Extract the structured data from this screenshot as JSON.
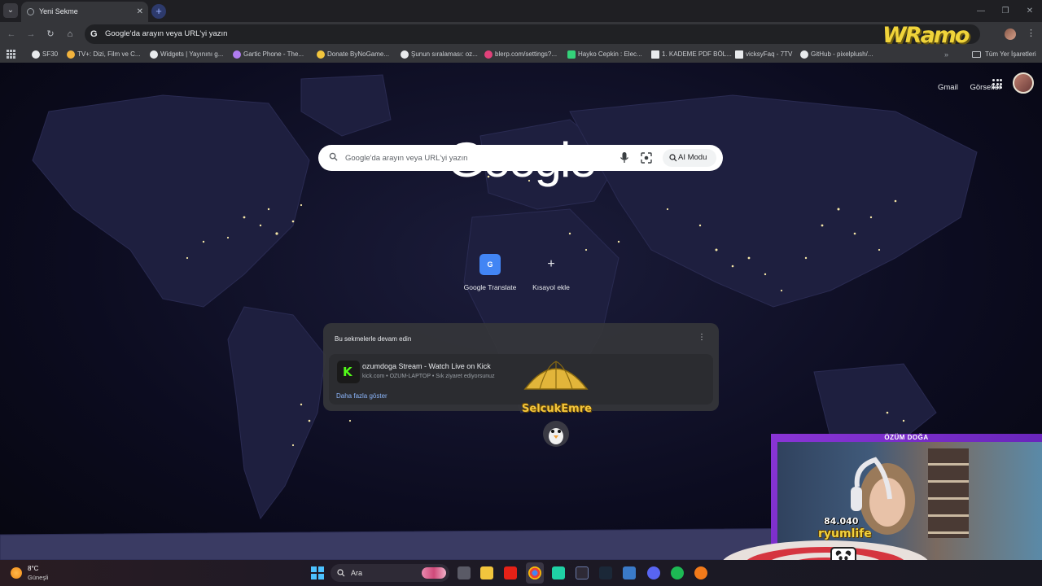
{
  "browser": {
    "tab": {
      "title": "Yeni Sekme"
    },
    "omnibox": {
      "text": "Google'da arayın veya URL'yi yazın"
    },
    "bookmarks": [
      {
        "label": "SF30",
        "color": "#e8eaed"
      },
      {
        "label": "TV+: Dizi, Film ve C...",
        "color": "#f2b33d"
      },
      {
        "label": "Widgets | Yayınını g...",
        "color": "#e8eaed"
      },
      {
        "label": "Gartic Phone - The...",
        "color": "#b07cf0"
      },
      {
        "label": "Donate ByNoGame...",
        "color": "#f2c53d"
      },
      {
        "label": "Şunun sıralaması: oz...",
        "color": "#e8eaed"
      },
      {
        "label": "blerp.com/settings?...",
        "color": "#e0417a"
      },
      {
        "label": "Hayko Cepkin : Elec...",
        "color": "#34d27a"
      },
      {
        "label": "1. KADEME PDF BÖL...",
        "color": "#e8eaed"
      },
      {
        "label": "vicksyFaq - 7TV",
        "color": "#e8eaed"
      },
      {
        "label": "GitHub - pixelplush/...",
        "color": "#e8eaed"
      }
    ],
    "bookmarks_more": "»",
    "bookmarks_folder": "Tüm Yer İşaretleri",
    "stream_logo": "WRamo"
  },
  "page": {
    "top_links": {
      "gmail": "Gmail",
      "images": "Görseller"
    },
    "logo": "Google",
    "search": {
      "placeholder": "Google'da arayın veya URL'yi yazın",
      "ai_mode_label": "AI Modu"
    },
    "shortcuts": [
      {
        "label": "Google Translate",
        "icon": "translate-icon"
      },
      {
        "label": "Kısayol ekle",
        "icon": "plus-icon"
      }
    ],
    "continue_card": {
      "title": "Bu sekmelerle devam edin",
      "item_title": "ozumdoga Stream - Watch Live on Kick",
      "item_subtitle": "kick.com • OZUM-LAPTOP • Sık ziyaret ediyorsunuz",
      "show_more": "Daha fazla göster"
    }
  },
  "stream_overlay": {
    "alert_name": "SelcukEmre",
    "cam_title": "ÖZÜM DOĞA",
    "count": "84.040",
    "username": "ryumlife"
  },
  "taskbar": {
    "weather_temp": "8°C",
    "weather_desc": "Güneşli",
    "search_label": "Ara"
  },
  "colors": {
    "accent_purple": "#8a35d6",
    "alert_yellow": "#f2c53d",
    "kick_green": "#53fc18",
    "link_blue": "#8ab4f8"
  }
}
